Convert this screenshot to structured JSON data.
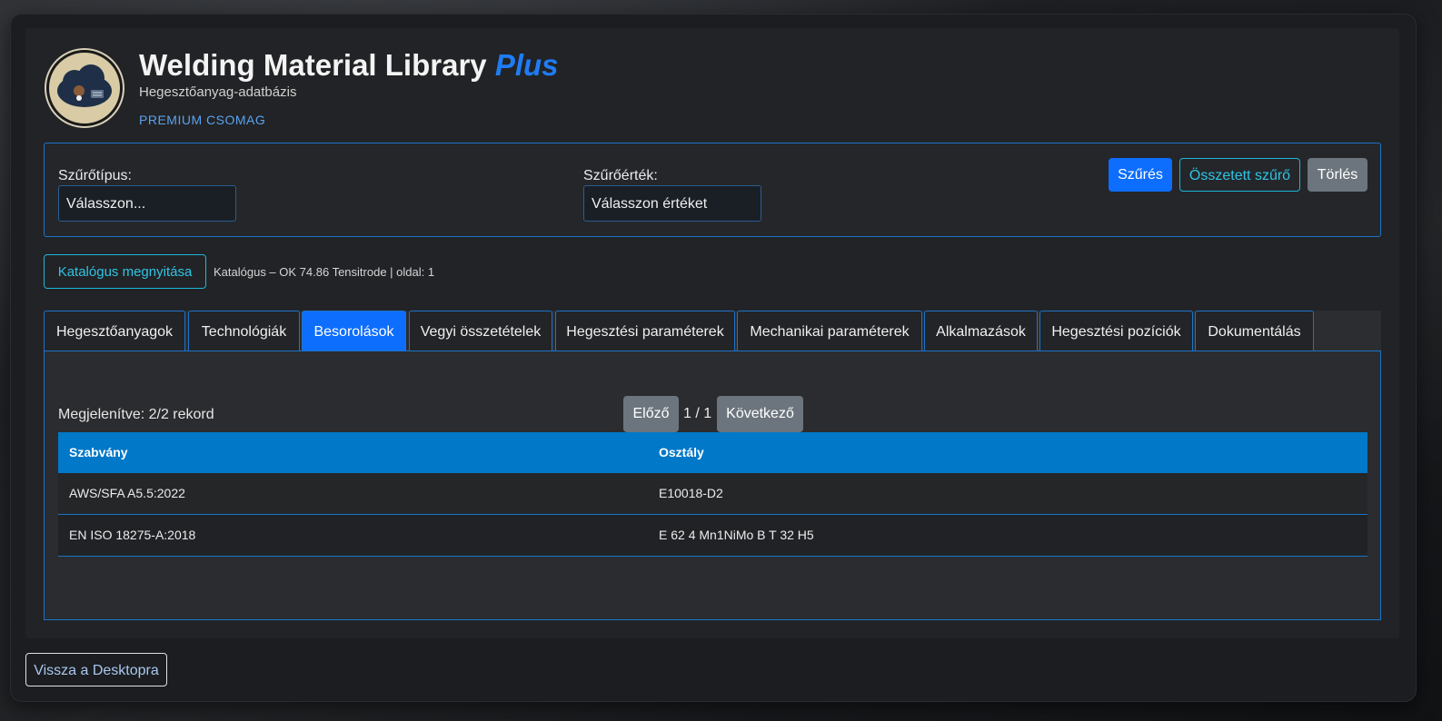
{
  "header": {
    "title_main": "Welding Material Library",
    "title_plus": "Plus",
    "subtitle": "Hegesztőanyag-adatbázis",
    "package": "PREMIUM CSOMAG"
  },
  "filter": {
    "type_label": "Szűrőtípus:",
    "type_value": "Válasszon...",
    "value_label": "Szűrőérték:",
    "value_value": "Válasszon értéket",
    "filter_button": "Szűrés",
    "compound_button": "Összetett szűrő",
    "clear_button": "Törlés"
  },
  "catalog": {
    "open_button": "Katalógus megnyitása",
    "info": "Katalógus – OK 74.86 Tensitrode | oldal: 1"
  },
  "tabs": [
    {
      "label": "Hegesztőanyagok"
    },
    {
      "label": "Technológiák"
    },
    {
      "label": "Besorolások"
    },
    {
      "label": "Vegyi összetételek"
    },
    {
      "label": "Hegesztési paraméterek"
    },
    {
      "label": "Mechanikai paraméterek"
    },
    {
      "label": "Alkalmazások"
    },
    {
      "label": "Hegesztési pozíciók"
    },
    {
      "label": "Dokumentálás"
    }
  ],
  "active_tab": "Besorolások",
  "content": {
    "records": "Megjelenítve: 2/2 rekord",
    "prev": "Előző",
    "page": "1 / 1",
    "next": "Következő",
    "columns": [
      "Szabvány",
      "Osztály"
    ],
    "rows": [
      [
        "AWS/SFA A5.5:2022",
        "E10018-D2"
      ],
      [
        "EN ISO 18275-A:2018",
        "E 62 4 Mn1NiMo B T 32 H5"
      ]
    ]
  },
  "footer": {
    "back_button": "Vissza a Desktopra"
  },
  "colors": {
    "accent": "#0d6efd",
    "table_header": "#0178c8",
    "outline": "#1fb6d6"
  }
}
